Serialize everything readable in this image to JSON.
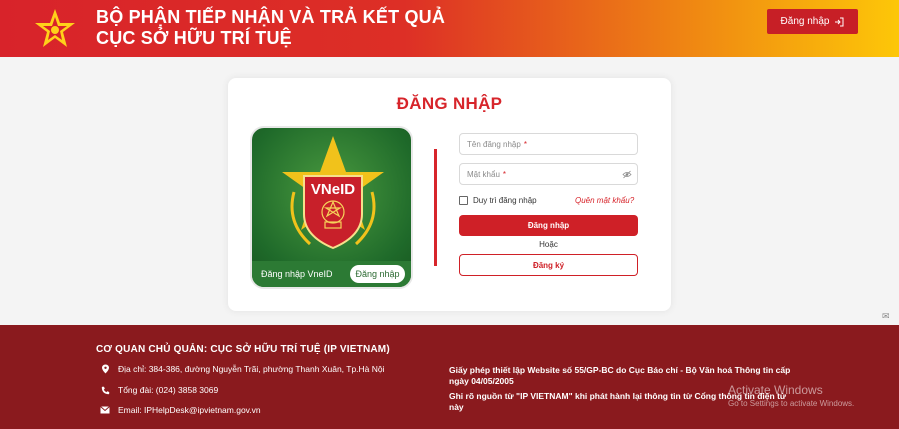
{
  "header": {
    "title_line1": "BỘ PHẬN TIẾP NHẬN VÀ TRẢ KẾT QUẢ",
    "title_line2": "CỤC SỞ HỮU TRÍ TUỆ",
    "login_button": "Đăng nhập",
    "login_icon": "login-arrow-icon"
  },
  "login": {
    "title": "ĐĂNG NHẬP",
    "vneid": {
      "brand": "VNeID",
      "label": "Đăng nhập VneID",
      "button": "Đăng nhập"
    },
    "username_placeholder": "Tên đăng nhập",
    "password_placeholder": "Mật khẩu",
    "required_mark": "*",
    "remember": "Duy trì đăng nhập",
    "forgot": "Quên mật khẩu?",
    "submit": "Đăng nhập",
    "or": "Hoặc",
    "register": "Đăng ký"
  },
  "footer": {
    "agency": "CƠ QUAN CHỦ QUẢN: CỤC SỞ HỮU TRÍ TUỆ (IP VIETNAM)",
    "address": "Địa chỉ: 384-386, đường Nguyễn Trãi, phường Thanh Xuân, Tp.Hà Nội",
    "phone": "Tổng đài: (024) 3858 3069",
    "email": "Email: IPHelpDesk@ipvietnam.gov.vn",
    "license": "Giấy phép thiết lập Website số 55/GP-BC do Cục Báo chí - Bộ Văn hoá Thông tin cấp ngày 04/05/2005",
    "source_note": "Ghi rõ nguồn từ \"IP VIETNAM\" khi phát hành lại thông tin từ Cổng thông tin điện tử này"
  },
  "watermark": {
    "line1": "Activate Windows",
    "line2": "Go to Settings to activate Windows."
  },
  "colors": {
    "primary_red": "#d7252b",
    "footer_bg": "#8a1a1e",
    "header_gradient_end": "#fdc708"
  }
}
